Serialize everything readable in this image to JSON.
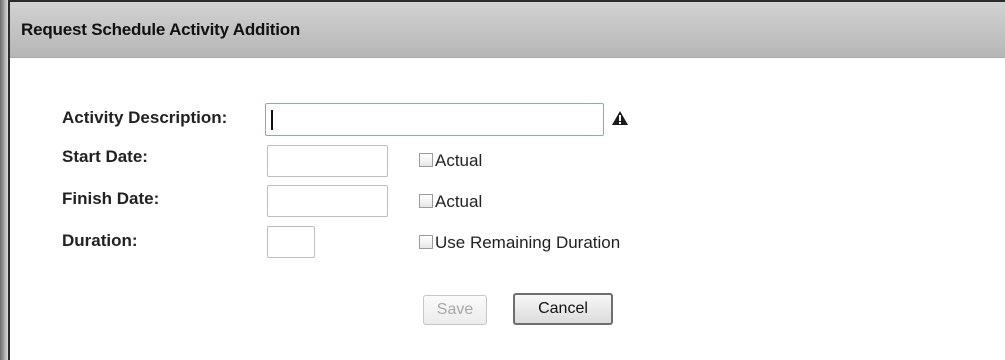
{
  "dialog": {
    "title": "Request Schedule Activity Addition"
  },
  "form": {
    "activity_description": {
      "label": "Activity Description:",
      "value": ""
    },
    "start_date": {
      "label": "Start Date:",
      "value": "",
      "actual_label": "Actual",
      "actual_checked": false
    },
    "finish_date": {
      "label": "Finish Date:",
      "value": "",
      "actual_label": "Actual",
      "actual_checked": false
    },
    "duration": {
      "label": "Duration:",
      "value": "",
      "use_remaining_label": "Use Remaining Duration",
      "use_remaining_checked": false
    }
  },
  "buttons": {
    "save_label": "Save",
    "save_enabled": false,
    "cancel_label": "Cancel"
  },
  "icons": {
    "required_warning": "warning-icon"
  }
}
